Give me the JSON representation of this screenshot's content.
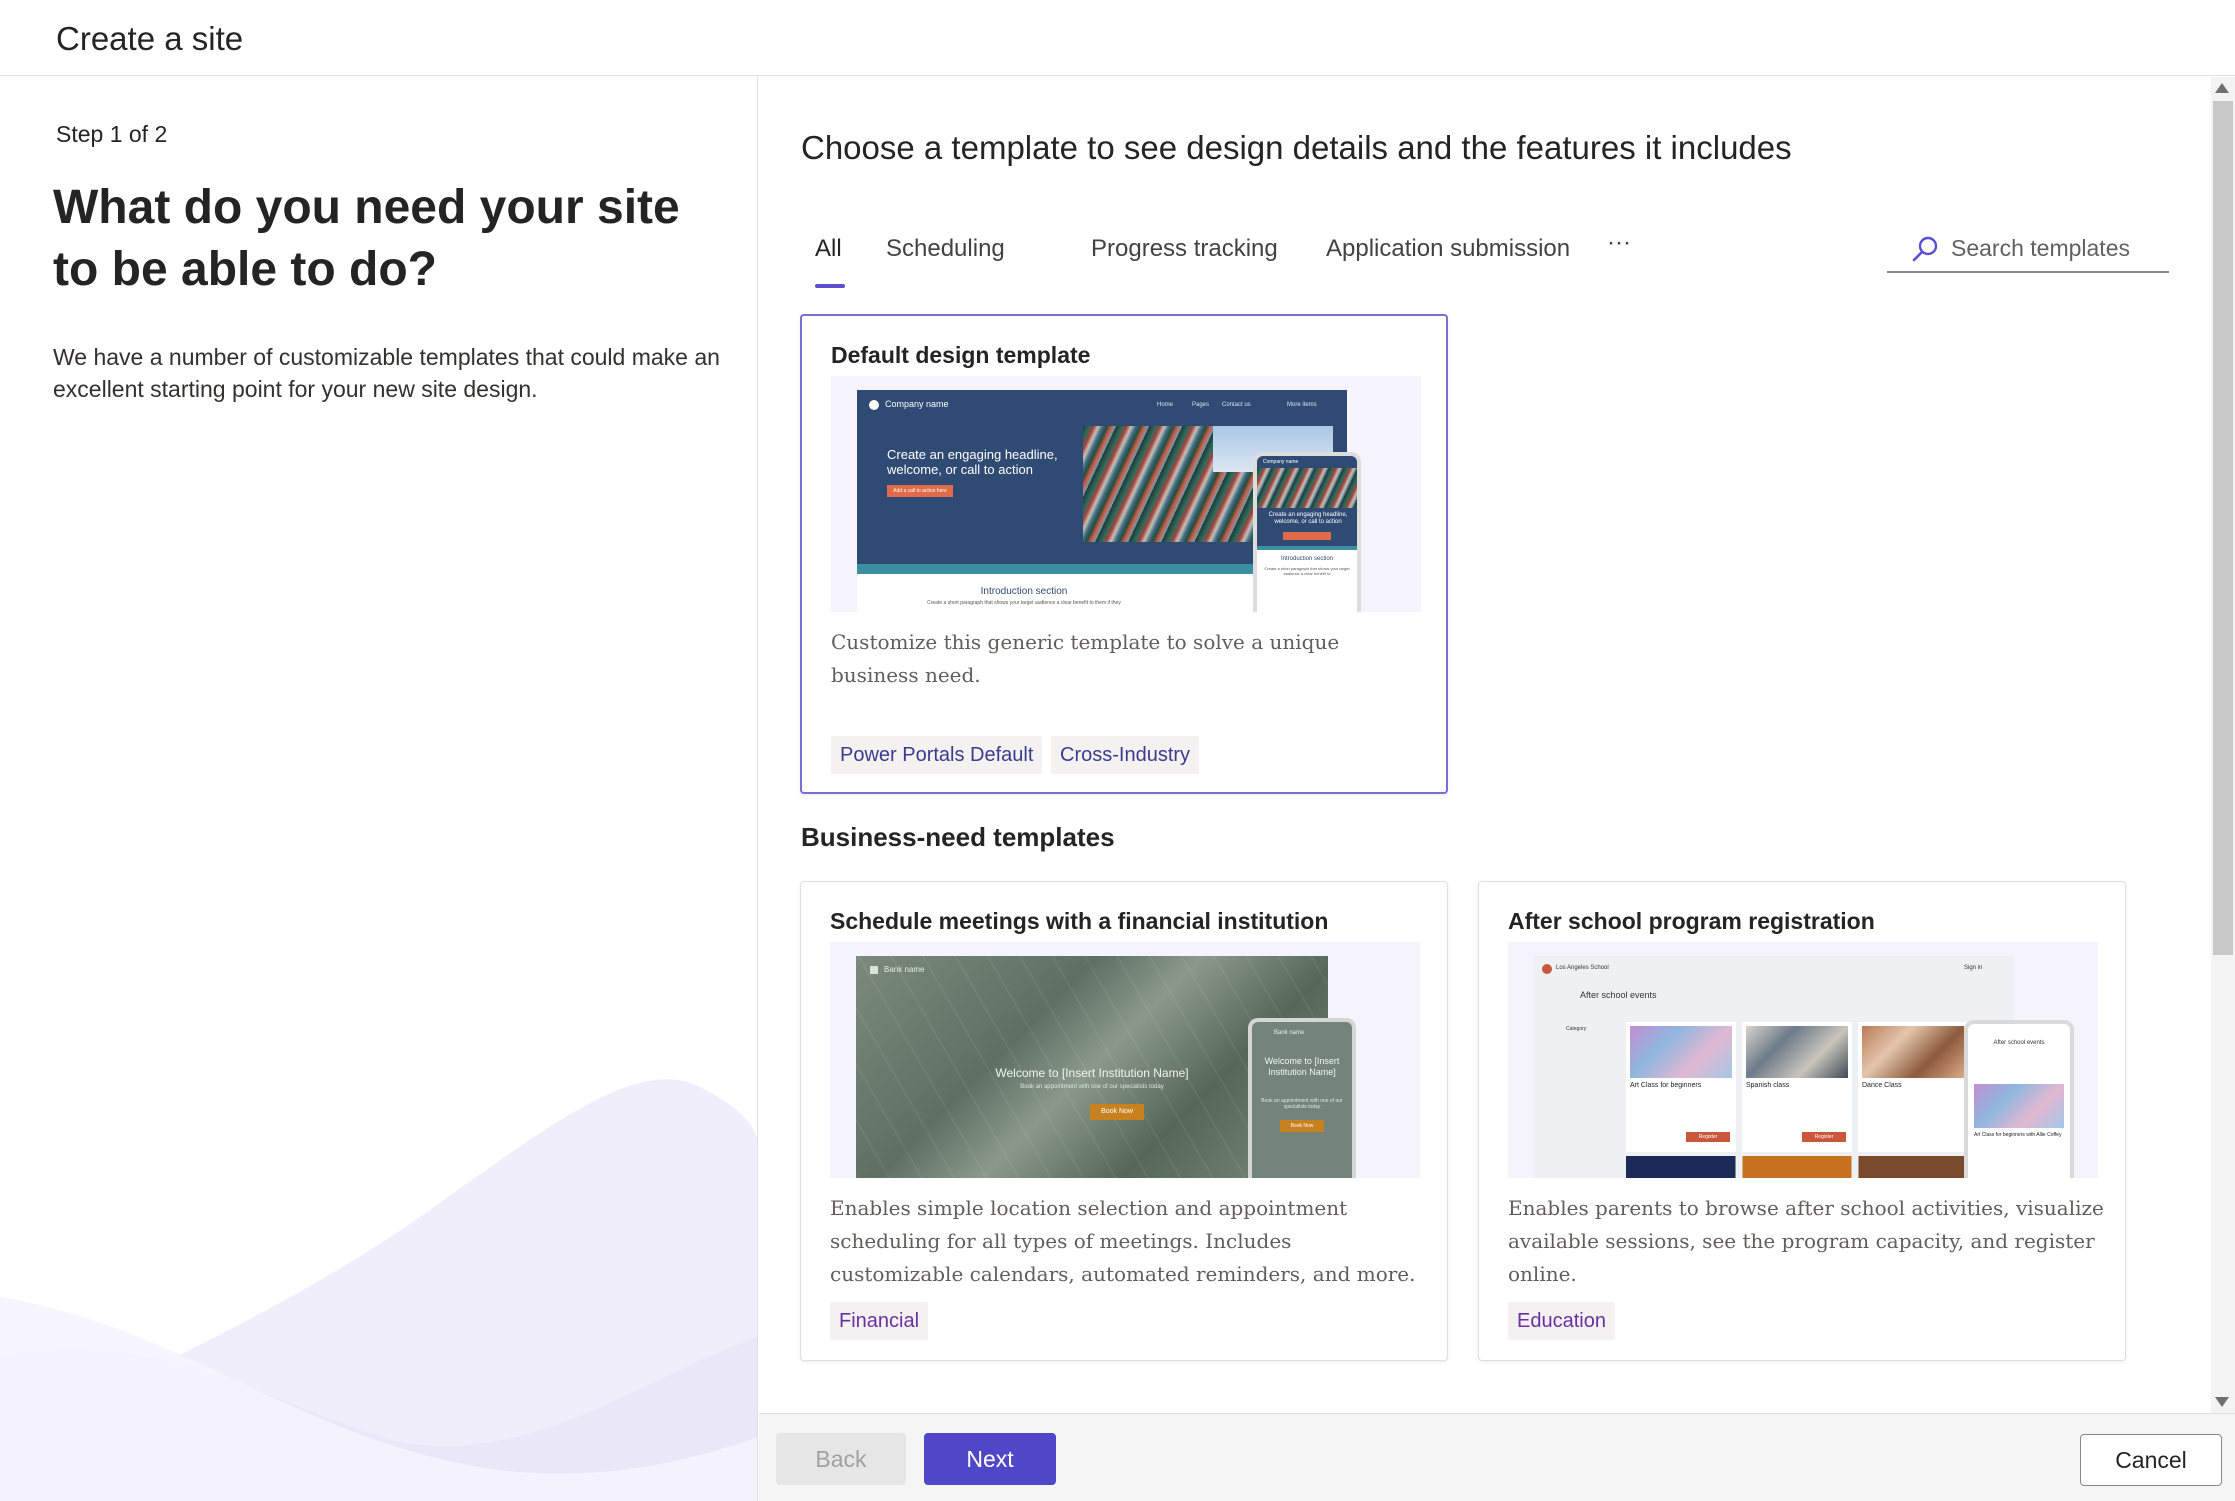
{
  "header": {
    "title": "Create a site"
  },
  "left": {
    "step": "Step 1 of 2",
    "question": "What do you need your site to be able to do?",
    "description": "We have a number of customizable templates that could make an excellent starting point for your new site design."
  },
  "main": {
    "heading": "Choose a template to see design details and the features it includes",
    "tabs": [
      {
        "label": "All",
        "active": true
      },
      {
        "label": "Scheduling"
      },
      {
        "label": "Progress tracking"
      },
      {
        "label": "Application submission"
      },
      {
        "label": "···"
      }
    ],
    "search": {
      "placeholder": "Search templates"
    },
    "featured": {
      "title": "Default design template",
      "description": "Customize this generic template to solve a unique business need.",
      "tags": [
        "Power Portals Default",
        "Cross-Industry"
      ],
      "preview": {
        "company": "Company name",
        "nav": [
          "Home",
          "Pages",
          "Contact us",
          "More items"
        ],
        "headline": "Create an engaging headline, welcome, or call to action",
        "cta": "Add a call to action here",
        "intro_title": "Introduction section",
        "intro_text": "Create a short paragraph that shows your target audience a clear benefit to them if they",
        "mobile_company": "Company name",
        "mobile_headline": "Create an engaging headline, welcome, or call to action",
        "mobile_intro_title": "Introduction section",
        "mobile_intro_text": "Create a short paragraph that shows your target audience a clear benefit to"
      }
    },
    "section_title": "Business-need templates",
    "templates": [
      {
        "title": "Schedule meetings with a financial institution",
        "description": "Enables simple location selection and appointment scheduling for all types of meetings. Includes customizable calendars, automated reminders, and more.",
        "tags": [
          "Financial"
        ],
        "preview": {
          "bank": "Bank name",
          "welcome": "Welcome to [Insert Institution Name]",
          "sub": "Book an appointment with one of our specialists today",
          "cta": "Book Now",
          "mobile_bank": "Bank name",
          "mobile_welcome": "Welcome to [Insert Institution Name]",
          "mobile_sub": "Book an appointment with one of our specialists today",
          "mobile_cta": "Book Now"
        }
      },
      {
        "title": "After school program registration",
        "description": "Enables parents to browse after school activities, visualize available sessions, see the program capacity, and register online.",
        "tags": [
          "Education"
        ],
        "preview": {
          "school": "Los Angeles School",
          "signin": "Sign in",
          "events_title": "After school events",
          "category": "Category",
          "classes": [
            "Art Class for beginners",
            "Spanish class",
            "Dance Class"
          ],
          "register": "Register",
          "mobile_title": "After school events",
          "mobile_class": "Art Class for beginners with Allie Coffey"
        }
      }
    ]
  },
  "footer": {
    "back": "Back",
    "next": "Next",
    "cancel": "Cancel"
  },
  "colors": {
    "accent": "#4f47c7",
    "tab_underline": "#5b4ed1",
    "selected_border": "#7a6fd6"
  }
}
